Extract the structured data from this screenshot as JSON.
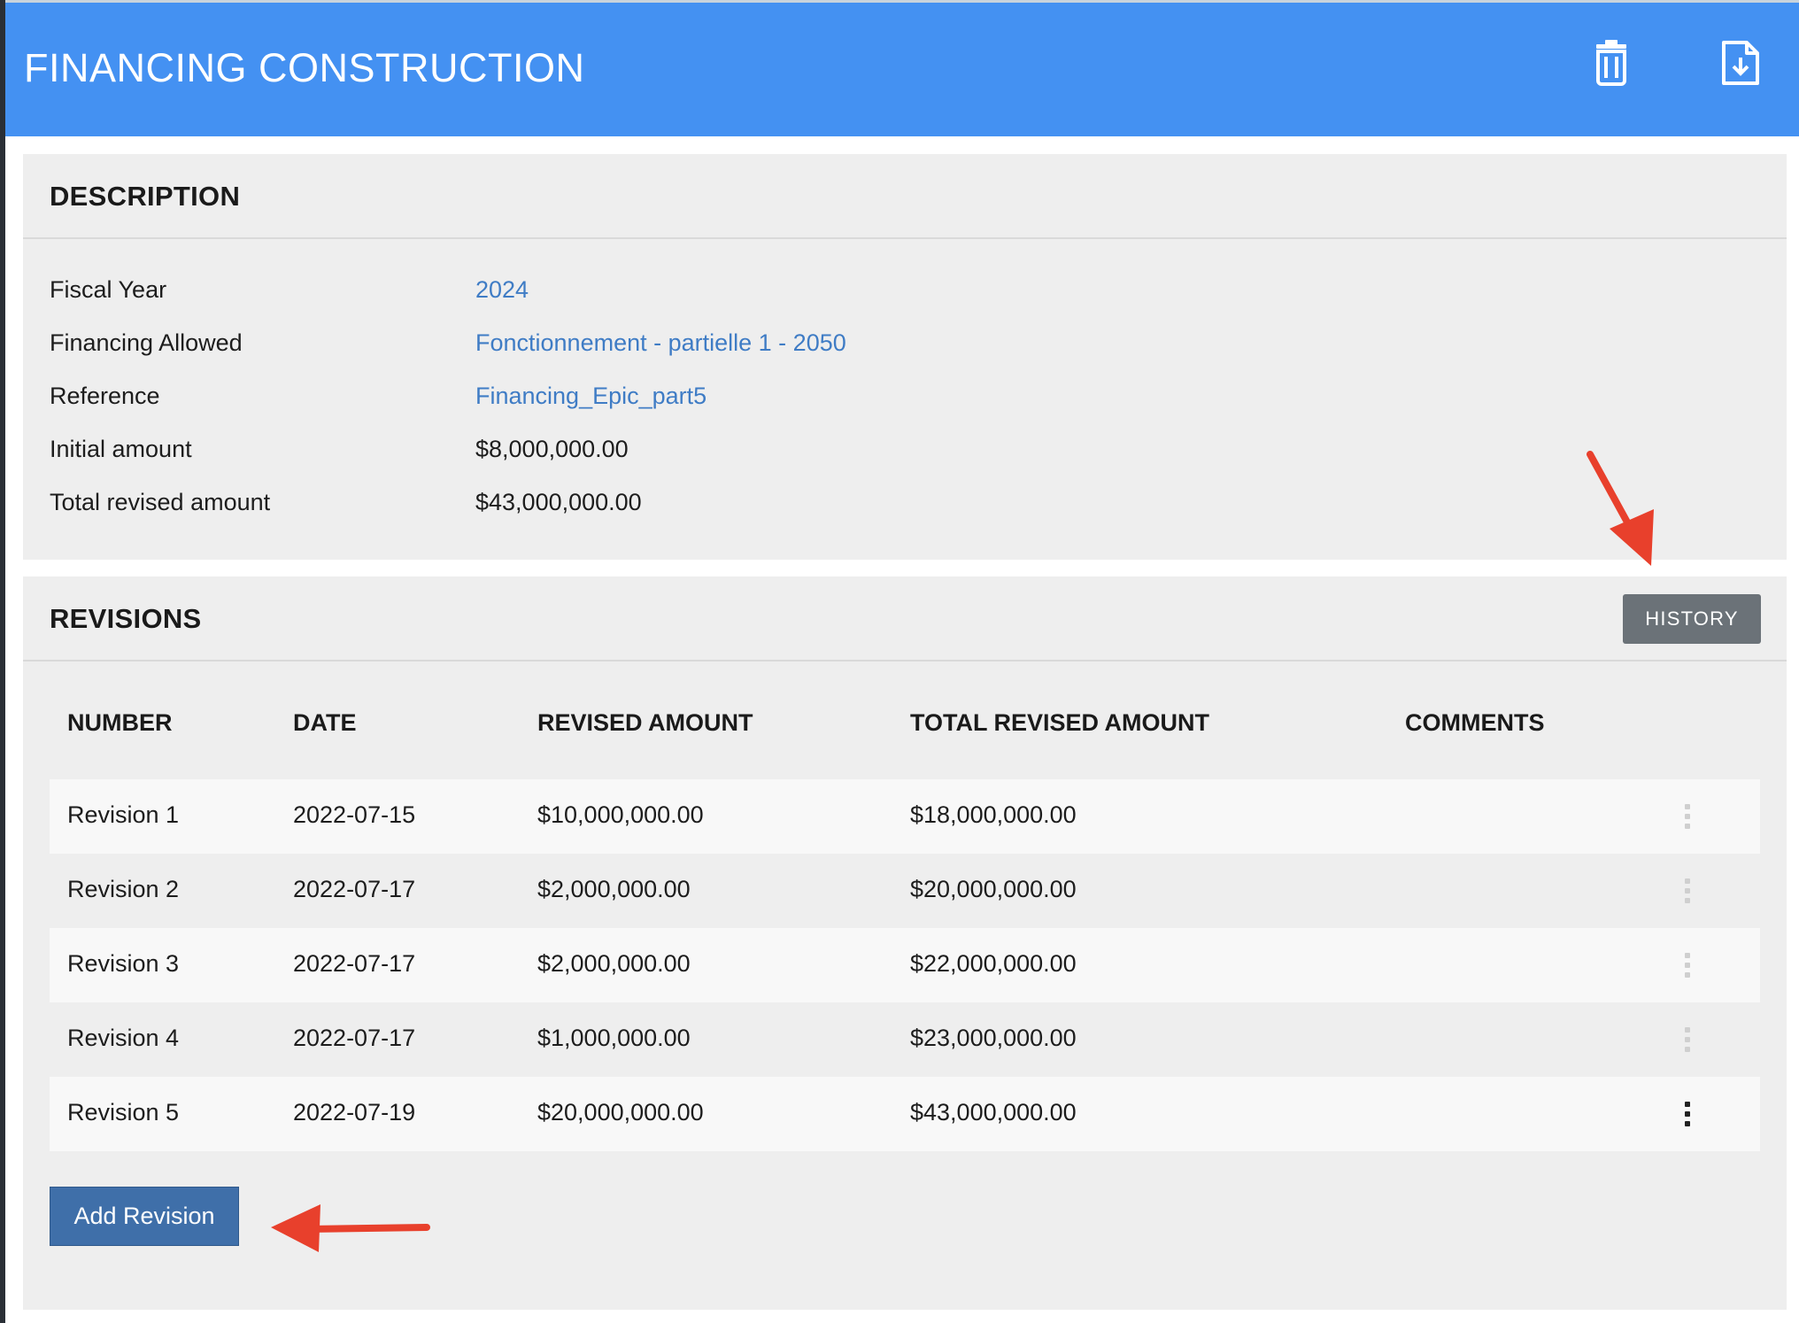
{
  "header": {
    "title": "FINANCING CONSTRUCTION",
    "bg_color": "#4491f2",
    "icons": {
      "delete": "trash-icon",
      "export": "file-download-icon"
    }
  },
  "description": {
    "title": "DESCRIPTION",
    "fields": [
      {
        "label": "Fiscal Year",
        "value": "2024",
        "is_link": true
      },
      {
        "label": "Financing Allowed",
        "value": "Fonctionnement - partielle 1 - 2050",
        "is_link": true
      },
      {
        "label": "Reference",
        "value": "Financing_Epic_part5",
        "is_link": true
      },
      {
        "label": "Initial amount",
        "value": "$8,000,000.00",
        "is_link": false
      },
      {
        "label": "Total revised amount",
        "value": "$43,000,000.00",
        "is_link": false
      }
    ]
  },
  "revisions": {
    "title": "REVISIONS",
    "history_label": "HISTORY",
    "columns": [
      "NUMBER",
      "DATE",
      "REVISED AMOUNT",
      "TOTAL REVISED AMOUNT",
      "COMMENTS"
    ],
    "rows": [
      {
        "number": "Revision 1",
        "date": "2022-07-15",
        "revised": "$10,000,000.00",
        "total": "$18,000,000.00",
        "comments": "",
        "menu_active": false
      },
      {
        "number": "Revision 2",
        "date": "2022-07-17",
        "revised": "$2,000,000.00",
        "total": "$20,000,000.00",
        "comments": "",
        "menu_active": false
      },
      {
        "number": "Revision 3",
        "date": "2022-07-17",
        "revised": "$2,000,000.00",
        "total": "$22,000,000.00",
        "comments": "",
        "menu_active": false
      },
      {
        "number": "Revision 4",
        "date": "2022-07-17",
        "revised": "$1,000,000.00",
        "total": "$23,000,000.00",
        "comments": "",
        "menu_active": false
      },
      {
        "number": "Revision 5",
        "date": "2022-07-19",
        "revised": "$20,000,000.00",
        "total": "$43,000,000.00",
        "comments": "",
        "menu_active": true
      }
    ],
    "add_label": "Add Revision"
  },
  "annotations": {
    "arrow_color": "#e8402c",
    "targets": [
      "history-button",
      "add-revision-button"
    ]
  }
}
